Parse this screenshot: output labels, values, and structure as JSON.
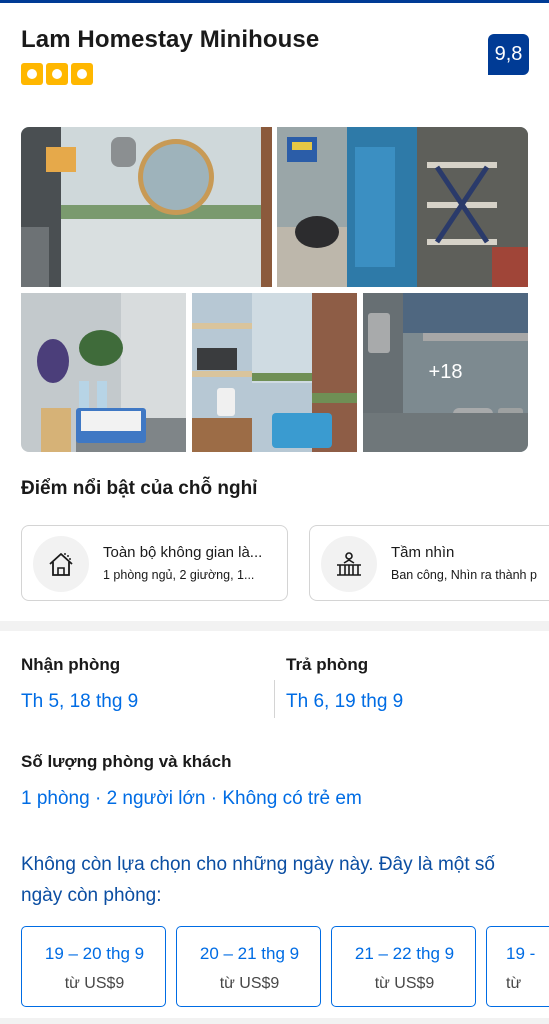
{
  "header": {
    "hotel_name": "Lam Homestay Minihouse",
    "stars": 3,
    "score": "9,8"
  },
  "gallery": {
    "more_photos": "+18",
    "photos": [
      {
        "name": "bathroom-mirror-photo"
      },
      {
        "name": "entrance-motorbike-photo"
      },
      {
        "name": "room-table-photo"
      },
      {
        "name": "kitchen-shelf-photo"
      },
      {
        "name": "shower-photo"
      }
    ]
  },
  "highlights": {
    "title": "Điểm nổi bật của chỗ nghỉ",
    "cards": [
      {
        "icon": "house-icon",
        "title": "Toàn bộ không gian là...",
        "subtitle": "1 phòng ngủ, 2 giường, 1..."
      },
      {
        "icon": "balcony-view-icon",
        "title": "Tầm nhìn",
        "subtitle": "Ban công, Nhìn ra thành p"
      }
    ]
  },
  "booking": {
    "checkin_label": "Nhận phòng",
    "checkin_value": "Th 5, 18 thg 9",
    "checkout_label": "Trả phòng",
    "checkout_value": "Th 6, 19 thg 9",
    "guests_label": "Số lượng phòng và khách",
    "guests_value": "1 phòng · 2 người lớn · Không có trẻ em",
    "unavailable_message": "Không còn lựa chọn cho những ngày này. Đây là một số ngày còn phòng:"
  },
  "alternatives": [
    {
      "dates": "19 – 20 thg 9",
      "price": "từ US$9"
    },
    {
      "dates": "20 – 21 thg 9",
      "price": "từ US$9"
    },
    {
      "dates": "21 – 22 thg 9",
      "price": "từ US$9"
    },
    {
      "dates": "19 -",
      "price": "từ"
    }
  ],
  "colors": {
    "brand": "#003b95",
    "link": "#006ce4",
    "star": "#ffb700",
    "message": "#0b4ea2"
  }
}
